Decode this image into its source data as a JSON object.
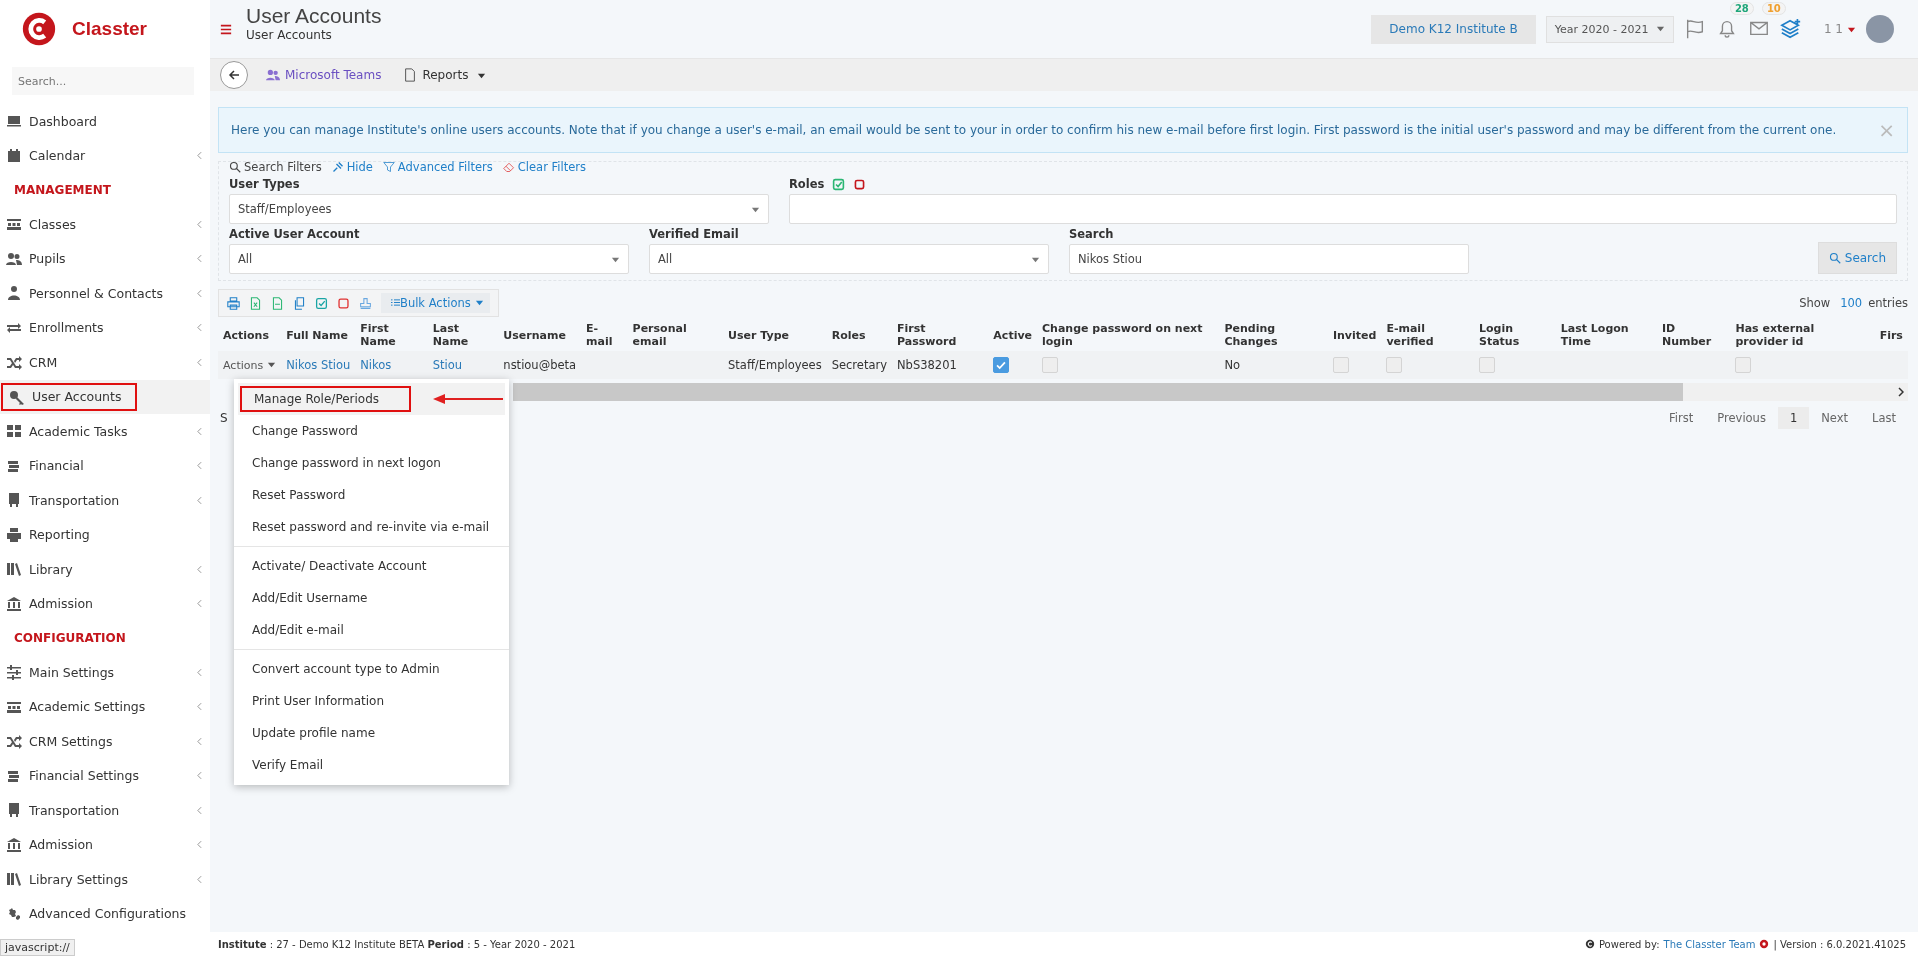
{
  "sidebar": {
    "logo": "Classter",
    "search": {
      "placeholder": "Search..."
    },
    "items": [
      {
        "kind": "link",
        "label": "Dashboard",
        "expandable": false,
        "selected": false
      },
      {
        "kind": "link",
        "label": "Calendar",
        "expandable": true,
        "selected": false
      },
      {
        "kind": "heading",
        "label": "MANAGEMENT"
      },
      {
        "kind": "link",
        "label": "Classes",
        "expandable": true,
        "selected": false
      },
      {
        "kind": "link",
        "label": "Pupils",
        "expandable": true,
        "selected": false
      },
      {
        "kind": "link",
        "label": "Personnel & Contacts",
        "expandable": true,
        "selected": false
      },
      {
        "kind": "link",
        "label": "Enrollments",
        "expandable": true,
        "selected": false
      },
      {
        "kind": "link",
        "label": "CRM",
        "expandable": true,
        "selected": false
      },
      {
        "kind": "link",
        "label": "User Accounts",
        "expandable": false,
        "selected": true,
        "highlighted": true
      },
      {
        "kind": "link",
        "label": "Academic Tasks",
        "expandable": true,
        "selected": false
      },
      {
        "kind": "link",
        "label": "Financial",
        "expandable": true,
        "selected": false
      },
      {
        "kind": "link",
        "label": "Transportation",
        "expandable": true,
        "selected": false
      },
      {
        "kind": "link",
        "label": "Reporting",
        "expandable": false,
        "selected": false
      },
      {
        "kind": "link",
        "label": "Library",
        "expandable": true,
        "selected": false
      },
      {
        "kind": "link",
        "label": "Admission",
        "expandable": true,
        "selected": false
      },
      {
        "kind": "heading",
        "label": "CONFIGURATION"
      },
      {
        "kind": "link",
        "label": "Main Settings",
        "expandable": true,
        "selected": false
      },
      {
        "kind": "link",
        "label": "Academic Settings",
        "expandable": true,
        "selected": false
      },
      {
        "kind": "link",
        "label": "CRM Settings",
        "expandable": true,
        "selected": false
      },
      {
        "kind": "link",
        "label": "Financial Settings",
        "expandable": true,
        "selected": false
      },
      {
        "kind": "link",
        "label": "Transportation",
        "expandable": true,
        "selected": false
      },
      {
        "kind": "link",
        "label": "Admission",
        "expandable": true,
        "selected": false
      },
      {
        "kind": "link",
        "label": "Library Settings",
        "expandable": true,
        "selected": false
      },
      {
        "kind": "link",
        "label": "Advanced Configurations",
        "expandable": false,
        "selected": false
      }
    ]
  },
  "header": {
    "title": "User Accounts",
    "breadcrumb": "User Accounts",
    "institute": "Demo K12 Institute B",
    "year": "Year 2020 - 2021",
    "notifications": "28",
    "messages": "10",
    "user": "1 1"
  },
  "toolbar": {
    "teams": "Microsoft Teams",
    "reports": "Reports"
  },
  "info": {
    "text": "Here you can manage Institute's online users accounts. Note that if you change a user's e-mail, an email would be sent to your in order to confirm his new e-mail before first login. First password is the initial user's password and may be different from the current one.",
    "close": "×"
  },
  "filters": {
    "links": [
      {
        "kind": "search",
        "label": "Search Filters"
      },
      {
        "kind": "hide",
        "label": "Hide"
      },
      {
        "kind": "advanced",
        "label": "Advanced Filters"
      },
      {
        "kind": "clear",
        "label": "Clear Filters"
      }
    ],
    "user_types": {
      "label": "User Types",
      "value": "Staff/Employees"
    },
    "roles": {
      "label": "Roles"
    },
    "active_account": {
      "label": "Active User Account",
      "value": "All"
    },
    "verified_email": {
      "label": "Verified Email",
      "value": "All"
    },
    "search": {
      "label": "Search",
      "value": "Nikos Stiou"
    },
    "search_button": "Search"
  },
  "table": {
    "bulk_actions": "Bulk Actions",
    "show": "Show",
    "page_size": "100",
    "entries": "entries",
    "columns": [
      "Actions",
      "Full Name",
      "First Name",
      "Last Name",
      "Username",
      "E-mail",
      "Personal email",
      "User Type",
      "Roles",
      "First Password",
      "Active",
      "Change password on next login",
      "Pending Changes",
      "Invited",
      "E-mail verified",
      "Login Status",
      "Last Logon Time",
      "ID Number",
      "Has external provider id",
      "Firs"
    ],
    "rows": [
      {
        "cells": [
          {
            "kind": "actions",
            "text": "Actions"
          },
          {
            "kind": "link",
            "text": "Nikos Stiou"
          },
          {
            "kind": "link",
            "text": "Nikos"
          },
          {
            "kind": "link",
            "text": "Stiou"
          },
          {
            "kind": "text",
            "text": "nstiou@beta"
          },
          {
            "kind": "empty"
          },
          {
            "kind": "empty"
          },
          {
            "kind": "text",
            "text": "Staff/Employees"
          },
          {
            "kind": "text",
            "text": "Secretary"
          },
          {
            "kind": "text",
            "text": "NbS38201"
          },
          {
            "kind": "checkbox",
            "checked": true
          },
          {
            "kind": "checkbox",
            "checked": false
          },
          {
            "kind": "text",
            "text": "No"
          },
          {
            "kind": "checkbox",
            "checked": false
          },
          {
            "kind": "checkbox",
            "checked": false
          },
          {
            "kind": "checkbox",
            "checked": false
          },
          {
            "kind": "empty"
          },
          {
            "kind": "empty"
          },
          {
            "kind": "checkbox",
            "checked": false
          },
          {
            "kind": "empty"
          }
        ]
      }
    ],
    "info": "S",
    "pagination": [
      {
        "label": "First",
        "selected": false
      },
      {
        "label": "Previous",
        "selected": false
      },
      {
        "label": "1",
        "selected": true
      },
      {
        "label": "Next",
        "selected": false
      },
      {
        "label": "Last",
        "selected": false
      }
    ]
  },
  "actions_menu": {
    "groups": [
      [
        {
          "label": "Manage Role/Periods",
          "highlighted": true
        },
        {
          "label": "Change Password",
          "highlighted": false
        },
        {
          "label": "Change password in next logon",
          "highlighted": false
        },
        {
          "label": "Reset Password",
          "highlighted": false
        },
        {
          "label": "Reset password and re-invite via e-mail",
          "highlighted": false
        }
      ],
      [
        {
          "label": "Activate/ Deactivate Account",
          "highlighted": false
        },
        {
          "label": "Add/Edit Username",
          "highlighted": false
        },
        {
          "label": "Add/Edit e-mail",
          "highlighted": false
        }
      ],
      [
        {
          "label": "Convert account type to Admin",
          "highlighted": false
        },
        {
          "label": "Print User Information",
          "highlighted": false
        },
        {
          "label": "Update profile name",
          "highlighted": false
        },
        {
          "label": "Verify Email",
          "highlighted": false
        }
      ]
    ]
  },
  "footer": {
    "left": "**Institute** : 27 - Demo K12 Institute BETA **Period** : 5 - Year 2020 - 2021",
    "powered": "Powered by:",
    "team": "The Classter Team",
    "version": "| Version : 6.0.2021.41025"
  },
  "status_bar": "javascript://"
}
